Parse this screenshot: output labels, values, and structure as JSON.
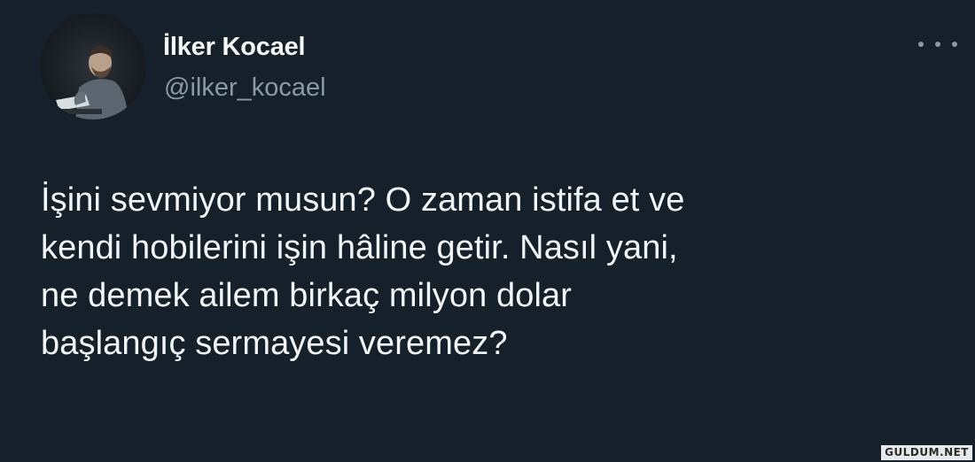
{
  "author": {
    "name": "İlker Kocael",
    "handle": "@ilker_kocael",
    "avatar_icon": "profile-photo"
  },
  "menu": {
    "more_icon": "more-horizontal-icon"
  },
  "tweet": {
    "lines": [
      "İşini sevmiyor musun? O zaman istifa et ve",
      "kendi hobilerini işin hâline getir. Nasıl yani,",
      "ne demek ailem birkaç milyon dolar",
      "başlangıç sermayesi veremez?"
    ]
  },
  "watermark": {
    "text": "GULDUM.NET"
  },
  "colors": {
    "background": "#15202b",
    "text_primary": "#f7f9f9",
    "text_secondary": "#8b98a5"
  }
}
